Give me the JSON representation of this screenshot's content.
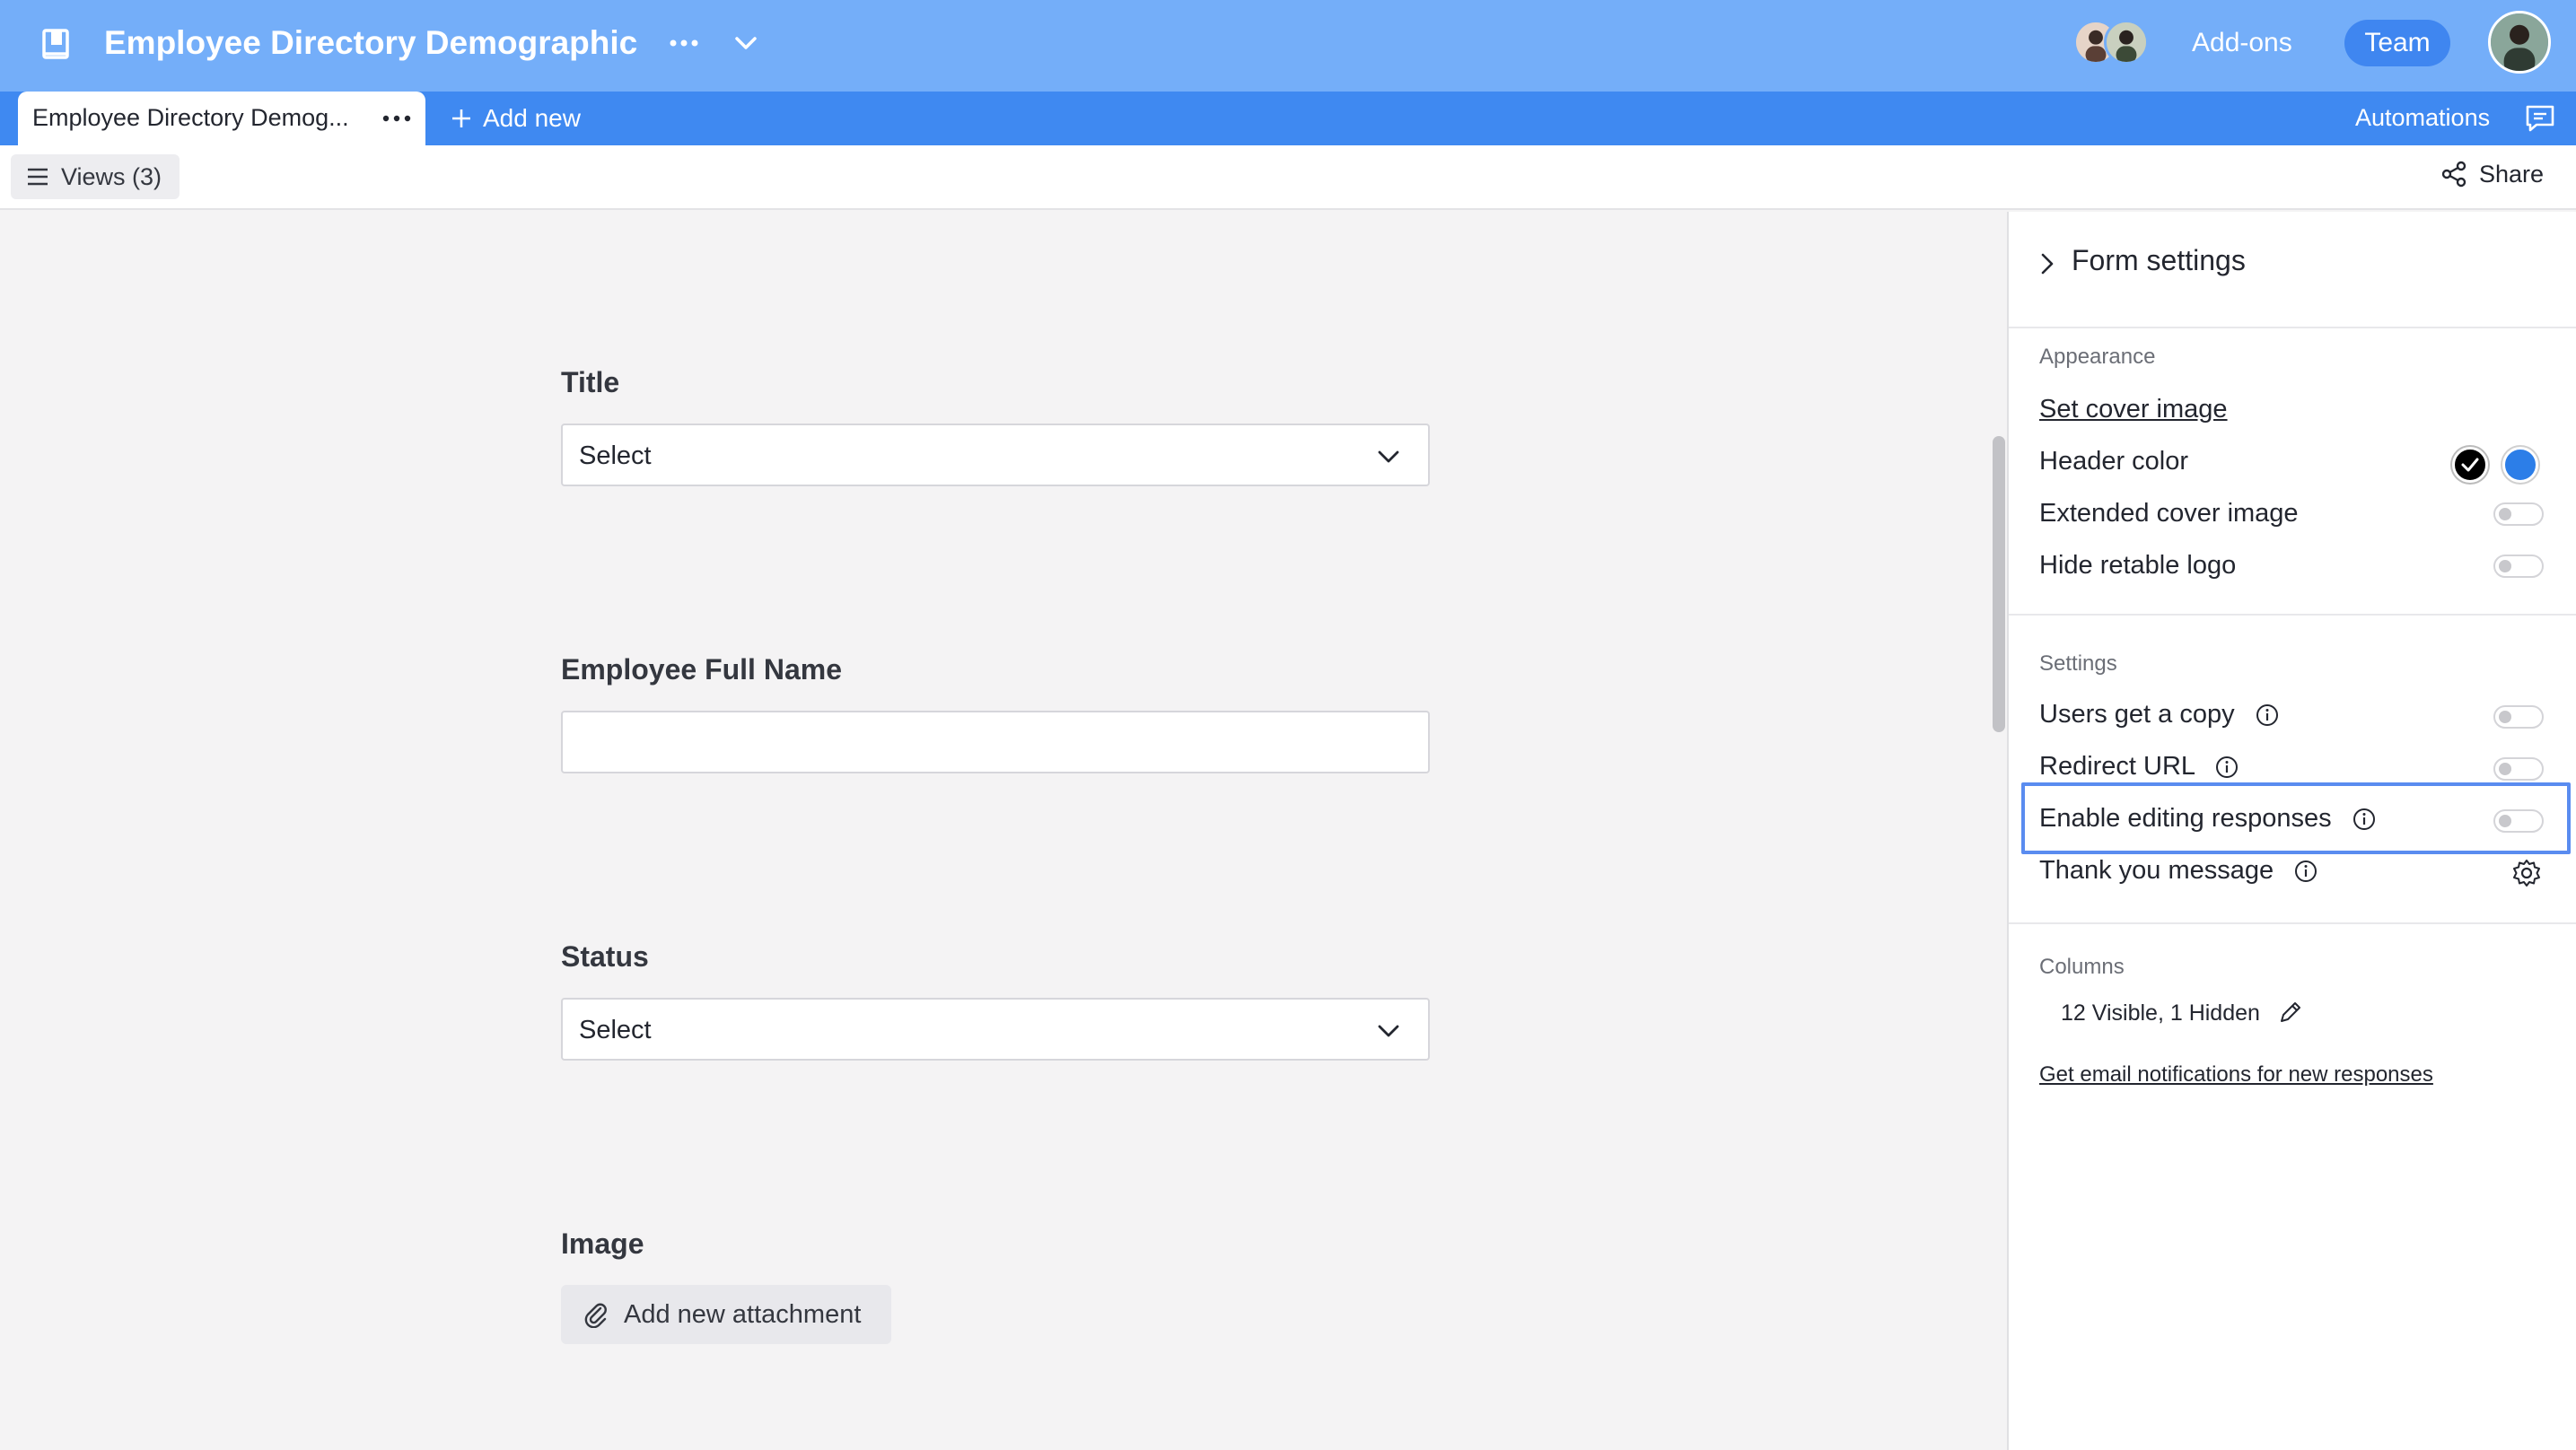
{
  "header": {
    "title": "Employee Directory Demographic",
    "addons_label": "Add-ons",
    "team_label": "Team",
    "accent_color": "#74aef9",
    "icons": [
      "book-icon",
      "more-dots-icon",
      "chevron-down-icon"
    ]
  },
  "tabs": {
    "active_label": "Employee Directory Demog...",
    "add_new_label": "Add new",
    "automations_label": "Automations",
    "bar_color": "#3f89f1"
  },
  "viewbar": {
    "views_label": "Views (3)",
    "share_label": "Share"
  },
  "form": {
    "fields": [
      {
        "label": "Title",
        "type": "select",
        "value": "Select"
      },
      {
        "label": "Employee Full Name",
        "type": "text",
        "value": ""
      },
      {
        "label": "Status",
        "type": "select",
        "value": "Select"
      },
      {
        "label": "Image",
        "type": "attachment",
        "button_label": "Add new attachment"
      }
    ]
  },
  "panel": {
    "title": "Form settings",
    "appearance": {
      "heading": "Appearance",
      "set_cover_image": "Set cover image",
      "header_color_label": "Header color",
      "header_color_options": [
        "#000000",
        "#2c7ee8"
      ],
      "header_color_selected": "#000000",
      "extended_cover_label": "Extended cover image",
      "extended_cover_on": false,
      "hide_logo_label": "Hide retable logo",
      "hide_logo_on": false
    },
    "settings": {
      "heading": "Settings",
      "users_copy_label": "Users get a copy",
      "users_copy_on": false,
      "redirect_url_label": "Redirect URL",
      "redirect_url_on": false,
      "enable_editing_label": "Enable editing responses",
      "enable_editing_on": false,
      "thank_you_label": "Thank you message"
    },
    "columns": {
      "heading": "Columns",
      "summary": "12 Visible, 1 Hidden",
      "email_link": "Get email notifications for new responses"
    }
  }
}
